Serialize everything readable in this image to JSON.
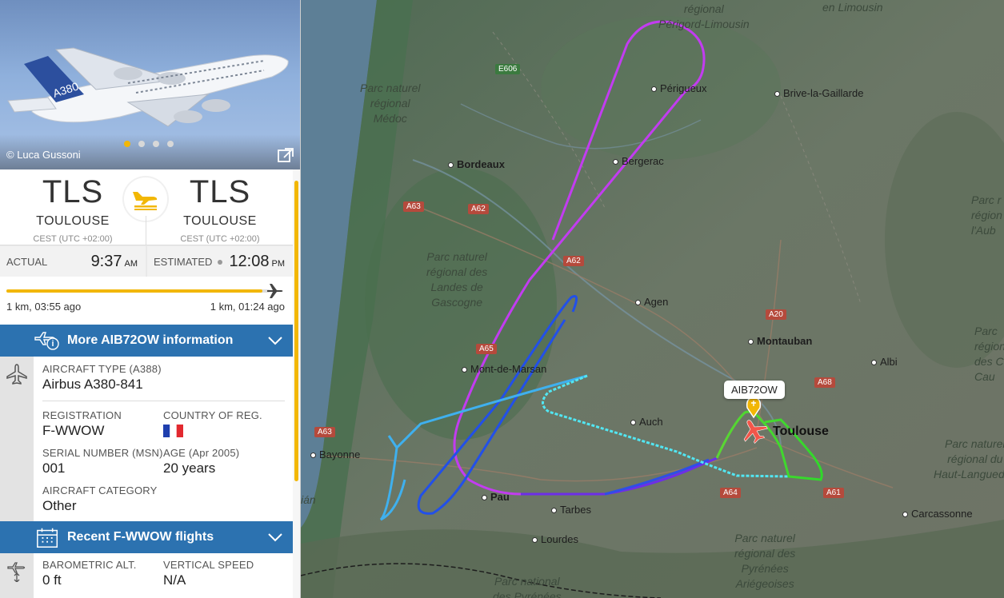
{
  "photo": {
    "credit": "© Luca Gussoni",
    "dots": 4,
    "active_dot": 0
  },
  "route": {
    "origin": {
      "code": "TLS",
      "city": "TOULOUSE",
      "tz": "CEST (UTC +02:00)"
    },
    "destination": {
      "code": "TLS",
      "city": "TOULOUSE",
      "tz": "CEST (UTC +02:00)"
    }
  },
  "times": {
    "actual_label": "ACTUAL",
    "actual_time": "9:37",
    "actual_ampm": "AM",
    "estimated_label": "ESTIMATED",
    "estimated_time": "12:08",
    "estimated_ampm": "PM"
  },
  "progress": {
    "fraction": 0.97,
    "left_text": "1 km, 03:55 ago",
    "right_text": "1 km, 01:24 ago"
  },
  "more_info": {
    "label": "More AIB72OW information"
  },
  "aircraft": {
    "type_label": "AIRCRAFT TYPE",
    "type_code": "(A388)",
    "type_value": "Airbus A380-841",
    "registration_label": "REGISTRATION",
    "registration_value": "F-WWOW",
    "country_label": "COUNTRY OF REG.",
    "msn_label": "SERIAL NUMBER (MSN)",
    "msn_value": "001",
    "age_label": "AGE (Apr 2005)",
    "age_value": "20 years",
    "category_label": "AIRCRAFT CATEGORY",
    "category_value": "Other"
  },
  "recent_flights": {
    "label": "Recent F-WWOW flights"
  },
  "telemetry": {
    "alt_label": "BAROMETRIC ALT.",
    "alt_value": "0 ft",
    "vs_label": "VERTICAL SPEED",
    "vs_value": "N/A"
  },
  "map": {
    "callsign": "AIB72OW",
    "cities": {
      "perigueux": "Périgueux",
      "brive": "Brive-la-Gaillarde",
      "bordeaux": "Bordeaux",
      "bergerac": "Bergerac",
      "agen": "Agen",
      "montauban": "Montauban",
      "albi": "Albi",
      "mont_de_marsan": "Mont-de-Marsan",
      "auch": "Auch",
      "toulouse": "Toulouse",
      "bayonne": "Bayonne",
      "pau": "Pau",
      "tarbes": "Tarbes",
      "lourdes": "Lourdes",
      "carcassonne": "Carcassonne"
    },
    "parks": {
      "medoc": "Parc naturel\nrégional\nMédoc",
      "landes": "Parc naturel\nrégional des\nLandes de\nGascogne",
      "perigord": "régional\nPérigord-Limousin",
      "limousin": "en Limousin",
      "pyrenees_ariegeoises": "Parc naturel\nrégional des\nPyrénées\nAriégeoises",
      "haut_languedoc": "Parc naturel\nrégional du\nHaut-Languedoc",
      "pyrenees_national": "Parc national\ndes Pyrénées",
      "right_top": "Parc r\nrégion\nl'Aub",
      "right_mid": "Parc\nrégion\ndes C\nCau",
      "left_edge": "ián"
    },
    "roads": [
      "E606",
      "A63",
      "A62",
      "A62",
      "A65",
      "A20",
      "A68",
      "A63",
      "A64",
      "A61"
    ],
    "colors": {
      "track_violet": "#c23cf0",
      "track_blue": "#2a5ee8",
      "track_cyan": "#52e6f2",
      "track_green": "#3fd63a",
      "aircraft": "#f2564a"
    }
  },
  "colors": {
    "accent": "#f2b705",
    "header_blue": "#2c72b0"
  }
}
